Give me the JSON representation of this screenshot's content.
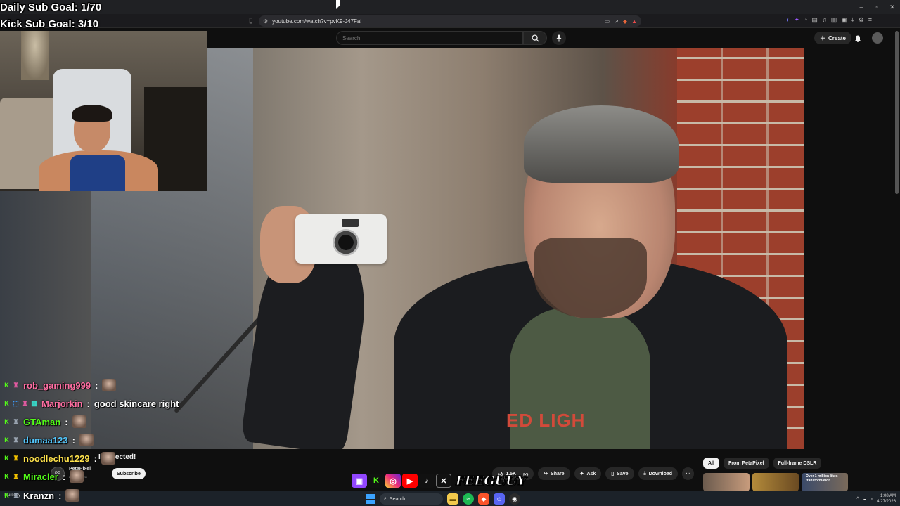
{
  "overlay": {
    "daily_goal": "Daily Sub Goal: 1/70",
    "kick_goal": "Kick Sub Goal: 3/10"
  },
  "browser": {
    "url": "youtube.com/watch?v=pvK9-J47Fal"
  },
  "youtube": {
    "search_placeholder": "Search",
    "create_label": "Create",
    "video_title": "I Expected!",
    "channel_name": "PetaPixel",
    "channel_subs": "subscribers",
    "subscribe_label": "Subscribe",
    "like_count": "1.5K",
    "share_label": "Share",
    "ask_label": "Ask",
    "save_label": "Save",
    "download_label": "Download",
    "chips": [
      "All",
      "From PetaPixel",
      "Full-frame DSLR"
    ],
    "thumb_caption": "Over 1 million likes transformation",
    "shirt_text": "ED LIGH"
  },
  "chat": [
    {
      "user": "rob_gaming999",
      "color": "#ff6fa3",
      "message": "",
      "emote": true
    },
    {
      "user": "Marjorkin",
      "color": "#ff6fa3",
      "message": "good skincare right",
      "emote": false
    },
    {
      "user": "GTAman",
      "color": "#53fc18",
      "message": "",
      "emote": true
    },
    {
      "user": "dumaa123",
      "color": "#53c6fc",
      "message": "",
      "emote": true
    },
    {
      "user": "noodlechu1229",
      "color": "#ffe34d",
      "message": "",
      "emote": true
    },
    {
      "user": "Miracler",
      "color": "#53fc18",
      "message": "",
      "emote": true
    },
    {
      "user": "Kranzn",
      "color": "#ffffff",
      "message": "",
      "emote": true
    }
  ],
  "taskbar": {
    "search_label": "Search",
    "left_text": "Thursday",
    "time": "1:08 AM",
    "date": "4/27/2026"
  },
  "brand": {
    "logo": "FEEGUUY"
  },
  "colors": {
    "kick_green": "#53fc18",
    "youtube_bg": "#0f0f0f"
  }
}
